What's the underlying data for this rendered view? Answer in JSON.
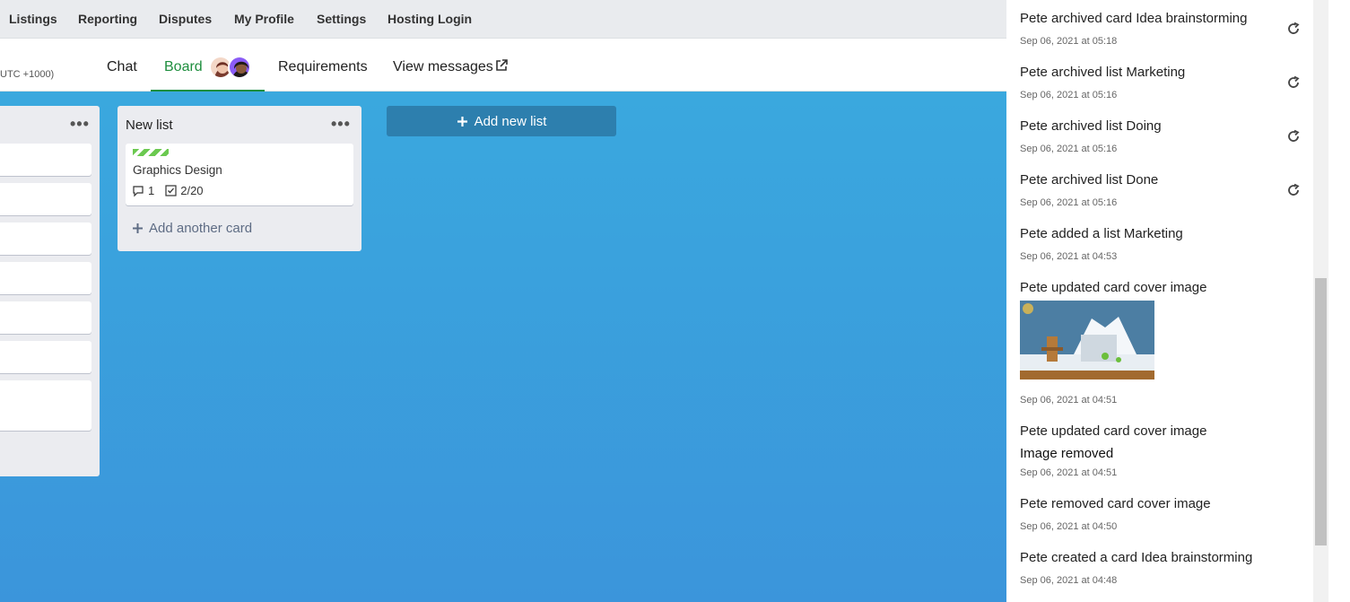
{
  "nav": {
    "items": [
      "Listings",
      "Reporting",
      "Disputes",
      "My Profile",
      "Settings",
      "Hosting Login"
    ]
  },
  "subheader": {
    "timezone": "UTC +1000)",
    "tabs": {
      "chat": "Chat",
      "board": "Board",
      "requirements": "Requirements",
      "view_messages": "View messages"
    }
  },
  "board": {
    "new_list": {
      "title": "New list",
      "card": {
        "title": "Graphics Design",
        "comments": "1",
        "checklist": "2/20"
      },
      "add_card_label": "Add another card"
    },
    "add_list_label": "Add new list"
  },
  "activity": [
    {
      "title": "Pete archived card Idea brainstorming",
      "time": "Sep 06, 2021 at 05:18",
      "undo": true
    },
    {
      "title": "Pete archived list Marketing",
      "time": "Sep 06, 2021 at 05:16",
      "undo": true
    },
    {
      "title": "Pete archived list Doing",
      "time": "Sep 06, 2021 at 05:16",
      "undo": true
    },
    {
      "title": "Pete archived list Done",
      "time": "Sep 06, 2021 at 05:16",
      "undo": true
    },
    {
      "title": "Pete added a list Marketing",
      "time": "Sep 06, 2021 at 04:53"
    },
    {
      "title": "Pete updated card cover image",
      "time": "Sep 06, 2021 at 04:51",
      "has_image": true
    },
    {
      "title": "Pete updated card cover image",
      "sub": "Image removed",
      "time": "Sep 06, 2021 at 04:51"
    },
    {
      "title": "Pete removed card cover image",
      "time": "Sep 06, 2021 at 04:50"
    },
    {
      "title": "Pete created a card Idea brainstorming",
      "time": "Sep 06, 2021 at 04:48"
    }
  ],
  "colors": {
    "accent_green": "#1e8e3e",
    "board_blue": "#3aa8de",
    "add_list_button": "#2d7fae"
  }
}
